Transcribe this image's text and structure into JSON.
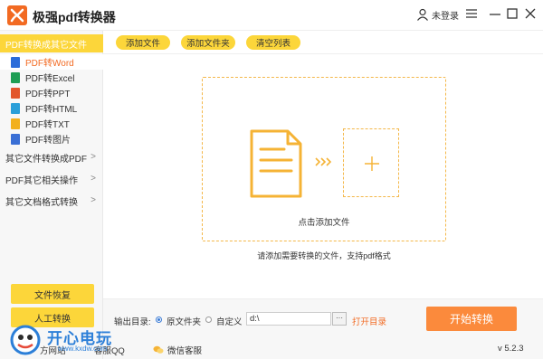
{
  "window": {
    "title": "极强pdf转换器",
    "user_label": "未登录"
  },
  "sidebar": {
    "active_category": "PDF转换成其它文件",
    "subitems": [
      {
        "label": "PDF转Word",
        "icon": "word-file-icon",
        "color": "#2b6cd9"
      },
      {
        "label": "PDF转Excel",
        "icon": "excel-file-icon",
        "color": "#1e9e54"
      },
      {
        "label": "PDF转PPT",
        "icon": "ppt-file-icon",
        "color": "#e2562b"
      },
      {
        "label": "PDF转HTML",
        "icon": "html-file-icon",
        "color": "#2b9fd9"
      },
      {
        "label": "PDF转TXT",
        "icon": "txt-file-icon",
        "color": "#f2b01e"
      },
      {
        "label": "PDF转图片",
        "icon": "image-file-icon",
        "color": "#3a6fd5"
      }
    ],
    "categories": [
      {
        "label": "其它文件转换成PDF"
      },
      {
        "label": "PDF其它相关操作"
      },
      {
        "label": "其它文档格式转换"
      }
    ],
    "bottom_buttons": {
      "file_recovery": "文件恢复",
      "manual_convert": "人工转换"
    }
  },
  "toolbar": {
    "add_file": "添加文件",
    "add_folder": "添加文件夹",
    "clear_list": "清空列表"
  },
  "dropzone": {
    "label": "点击添加文件",
    "hint": "请添加需要转换的文件，支持pdf格式"
  },
  "output": {
    "label": "输出目录:",
    "option_original": "原文件夹",
    "option_custom": "自定义",
    "path_value": "d:\\",
    "browse_label": "···",
    "open_dir": "打开目录",
    "start_button": "开始转换",
    "selected_option": "原文件夹"
  },
  "footer": {
    "qq_label": "客服QQ",
    "wechat_label": "微信客服",
    "version": "v 5.2.3",
    "partial_label": "方网站"
  },
  "watermark": {
    "text": "开心电玩",
    "url": "www.kxdw.com"
  },
  "colors": {
    "accent_yellow": "#fcd63a",
    "accent_orange": "#f26a22",
    "start_button": "#fb8a3c",
    "dash_border": "#f4b84a"
  }
}
